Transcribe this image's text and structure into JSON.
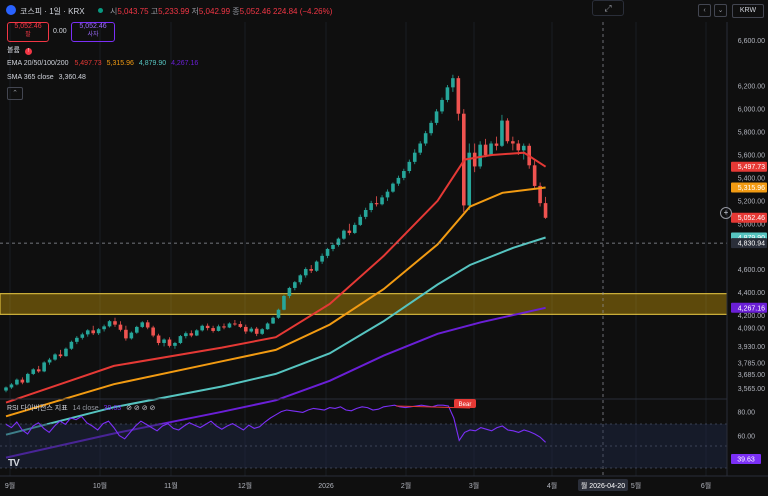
{
  "header": {
    "symbol_name": "코스피 · 1일 · KRX",
    "ohlc": {
      "open_label": "시",
      "open": "5,043.75",
      "high_label": "고",
      "high": "5,233.99",
      "low_label": "저",
      "low": "5,042.99",
      "close_label": "종",
      "close": "5,052.46",
      "change": "224.84 (−4.26%)"
    },
    "sell": {
      "price": "5,052.46",
      "label": "팔"
    },
    "spread": "0.00",
    "buy": {
      "price": "5,052.46",
      "label": "사자"
    },
    "currency": "KRW"
  },
  "indicators": {
    "volume_label": "볼륨",
    "ema_label": "EMA 20/50/100/200",
    "ema_values": [
      "5,497.73",
      "5,315.96",
      "4,879.90",
      "4,267.16"
    ],
    "sma_label": "SMA 365 close",
    "sma_value": "3,360.48"
  },
  "rsi": {
    "label": "RSI 다이버전스 지표",
    "params": "14 close",
    "value": "39.63",
    "bear_label": "Bear",
    "levels": [
      "80.00",
      "60.00"
    ]
  },
  "price_axis": {
    "ticks": [
      "6,600.00",
      "6,200.00",
      "6,000.00",
      "5,800.00",
      "5,600.00",
      "5,400.00",
      "5,200.00",
      "5,000.00",
      "4,600.00",
      "4,400.00",
      "4,200.00",
      "4,090.00",
      "3,930.00",
      "3,785.00",
      "3,685.00",
      "3,565.00"
    ],
    "labels": [
      {
        "text": "5,497.73",
        "color": "#e53935"
      },
      {
        "text": "5,315.96",
        "color": "#f29b12"
      },
      {
        "text": "5,052.46",
        "color": "#e53935"
      },
      {
        "text": "4,879.90",
        "color": "#56c4c0"
      },
      {
        "text": "4,830.94",
        "color": "#2a2e39"
      },
      {
        "text": "4,267.16",
        "color": "#6a1fd6"
      }
    ]
  },
  "time_axis": {
    "ticks": [
      "9월",
      "10월",
      "11월",
      "12월",
      "2026",
      "2월",
      "3월",
      "4월",
      "5월",
      "6월"
    ],
    "cursor_date": "월 2026-04-20"
  },
  "chart_data": {
    "type": "candlestick",
    "x_ticks": [
      "9월",
      "10월",
      "11월",
      "12월",
      "2026",
      "2월",
      "3월",
      "4월",
      "5월",
      "6월"
    ],
    "y_ticks": [
      6600,
      6200,
      6000,
      5800,
      5600,
      5400,
      5200,
      5000,
      4600,
      4400,
      4200,
      4090,
      3930,
      3785,
      3685,
      3565
    ],
    "ylim": [
      3480,
      6760
    ],
    "candles": [
      [
        3545,
        3580,
        3530,
        3572
      ],
      [
        3572,
        3610,
        3560,
        3598
      ],
      [
        3598,
        3650,
        3590,
        3640
      ],
      [
        3640,
        3660,
        3600,
        3615
      ],
      [
        3615,
        3700,
        3610,
        3690
      ],
      [
        3690,
        3740,
        3680,
        3730
      ],
      [
        3730,
        3760,
        3700,
        3712
      ],
      [
        3712,
        3800,
        3705,
        3790
      ],
      [
        3790,
        3830,
        3770,
        3815
      ],
      [
        3815,
        3870,
        3805,
        3860
      ],
      [
        3860,
        3900,
        3830,
        3845
      ],
      [
        3845,
        3920,
        3840,
        3910
      ],
      [
        3910,
        3980,
        3900,
        3970
      ],
      [
        3970,
        4020,
        3950,
        4005
      ],
      [
        4005,
        4050,
        3990,
        4035
      ],
      [
        4035,
        4080,
        4015,
        4070
      ],
      [
        4070,
        4110,
        4030,
        4045
      ],
      [
        4045,
        4090,
        4030,
        4080
      ],
      [
        4080,
        4120,
        4060,
        4105
      ],
      [
        4105,
        4160,
        4095,
        4150
      ],
      [
        4150,
        4180,
        4100,
        4120
      ],
      [
        4120,
        4150,
        4060,
        4075
      ],
      [
        4075,
        4110,
        3980,
        4000
      ],
      [
        4000,
        4060,
        3990,
        4050
      ],
      [
        4050,
        4110,
        4040,
        4100
      ],
      [
        4100,
        4150,
        4090,
        4140
      ],
      [
        4140,
        4160,
        4080,
        4095
      ],
      [
        4095,
        4110,
        4010,
        4025
      ],
      [
        4025,
        4040,
        3940,
        3960
      ],
      [
        3960,
        4000,
        3930,
        3990
      ],
      [
        3990,
        4010,
        3920,
        3935
      ],
      [
        3935,
        3970,
        3910,
        3960
      ],
      [
        3960,
        4030,
        3950,
        4020
      ],
      [
        4020,
        4060,
        4000,
        4045
      ],
      [
        4045,
        4070,
        4010,
        4025
      ],
      [
        4025,
        4080,
        4020,
        4070
      ],
      [
        4070,
        4120,
        4060,
        4110
      ],
      [
        4110,
        4130,
        4070,
        4090
      ],
      [
        4090,
        4110,
        4050,
        4065
      ],
      [
        4065,
        4120,
        4060,
        4105
      ],
      [
        4105,
        4130,
        4080,
        4095
      ],
      [
        4095,
        4140,
        4090,
        4130
      ],
      [
        4130,
        4160,
        4110,
        4125
      ],
      [
        4125,
        4150,
        4090,
        4100
      ],
      [
        4100,
        4120,
        4040,
        4060
      ],
      [
        4060,
        4100,
        4050,
        4085
      ],
      [
        4085,
        4100,
        4020,
        4040
      ],
      [
        4040,
        4090,
        4030,
        4080
      ],
      [
        4080,
        4140,
        4075,
        4130
      ],
      [
        4130,
        4190,
        4125,
        4180
      ],
      [
        4180,
        4260,
        4170,
        4250
      ],
      [
        4250,
        4380,
        4245,
        4370
      ],
      [
        4370,
        4450,
        4350,
        4440
      ],
      [
        4440,
        4500,
        4420,
        4490
      ],
      [
        4490,
        4560,
        4470,
        4550
      ],
      [
        4550,
        4620,
        4530,
        4605
      ],
      [
        4605,
        4640,
        4570,
        4590
      ],
      [
        4590,
        4680,
        4580,
        4670
      ],
      [
        4670,
        4740,
        4650,
        4720
      ],
      [
        4720,
        4790,
        4700,
        4780
      ],
      [
        4780,
        4830,
        4760,
        4815
      ],
      [
        4815,
        4880,
        4800,
        4870
      ],
      [
        4870,
        4950,
        4860,
        4940
      ],
      [
        4940,
        5000,
        4900,
        4920
      ],
      [
        4920,
        5010,
        4910,
        4990
      ],
      [
        4990,
        5080,
        4980,
        5060
      ],
      [
        5060,
        5140,
        5040,
        5120
      ],
      [
        5120,
        5200,
        5100,
        5180
      ],
      [
        5180,
        5240,
        5150,
        5170
      ],
      [
        5170,
        5250,
        5160,
        5230
      ],
      [
        5230,
        5300,
        5200,
        5280
      ],
      [
        5280,
        5360,
        5270,
        5350
      ],
      [
        5350,
        5420,
        5330,
        5400
      ],
      [
        5400,
        5480,
        5380,
        5460
      ],
      [
        5460,
        5560,
        5440,
        5540
      ],
      [
        5540,
        5650,
        5520,
        5620
      ],
      [
        5620,
        5720,
        5600,
        5700
      ],
      [
        5700,
        5810,
        5680,
        5790
      ],
      [
        5790,
        5900,
        5770,
        5880
      ],
      [
        5880,
        6000,
        5860,
        5980
      ],
      [
        5980,
        6100,
        5960,
        6080
      ],
      [
        6080,
        6210,
        6060,
        6190
      ],
      [
        6190,
        6300,
        6150,
        6270
      ],
      [
        6270,
        6290,
        5900,
        5960
      ],
      [
        5960,
        6000,
        5100,
        5160
      ],
      [
        5160,
        5700,
        5120,
        5620
      ],
      [
        5620,
        5700,
        5450,
        5500
      ],
      [
        5500,
        5720,
        5480,
        5690
      ],
      [
        5690,
        5740,
        5580,
        5600
      ],
      [
        5600,
        5720,
        5590,
        5700
      ],
      [
        5700,
        5760,
        5640,
        5680
      ],
      [
        5680,
        5950,
        5670,
        5900
      ],
      [
        5900,
        5920,
        5700,
        5720
      ],
      [
        5720,
        5760,
        5640,
        5700
      ],
      [
        5700,
        5730,
        5600,
        5640
      ],
      [
        5640,
        5700,
        5560,
        5680
      ],
      [
        5680,
        5700,
        5480,
        5510
      ],
      [
        5510,
        5560,
        5300,
        5330
      ],
      [
        5330,
        5360,
        5150,
        5180
      ],
      [
        5180,
        5234,
        5043,
        5052
      ]
    ],
    "series": [
      {
        "name": "EMA 20",
        "color": "#e53935",
        "values": [
          [
            0,
            3440
          ],
          [
            20,
            3760
          ],
          [
            40,
            3920
          ],
          [
            50,
            4010
          ],
          [
            60,
            4300
          ],
          [
            70,
            4720
          ],
          [
            80,
            5200
          ],
          [
            85,
            5560
          ],
          [
            90,
            5600
          ],
          [
            96,
            5620
          ],
          [
            100,
            5497.73
          ]
        ]
      },
      {
        "name": "EMA 50",
        "color": "#f29b12",
        "values": [
          [
            0,
            3320
          ],
          [
            20,
            3600
          ],
          [
            40,
            3800
          ],
          [
            50,
            3900
          ],
          [
            60,
            4120
          ],
          [
            70,
            4430
          ],
          [
            80,
            4820
          ],
          [
            86,
            5150
          ],
          [
            92,
            5270
          ],
          [
            100,
            5315.96
          ]
        ]
      },
      {
        "name": "EMA 100",
        "color": "#56c4c0",
        "values": [
          [
            0,
            3160
          ],
          [
            20,
            3400
          ],
          [
            40,
            3580
          ],
          [
            50,
            3690
          ],
          [
            60,
            3870
          ],
          [
            70,
            4150
          ],
          [
            80,
            4470
          ],
          [
            86,
            4640
          ],
          [
            94,
            4790
          ],
          [
            100,
            4879.9
          ]
        ]
      },
      {
        "name": "EMA 200",
        "color": "#6a1fd6",
        "values": [
          [
            0,
            2960
          ],
          [
            20,
            3170
          ],
          [
            40,
            3360
          ],
          [
            50,
            3460
          ],
          [
            60,
            3630
          ],
          [
            70,
            3850
          ],
          [
            80,
            4040
          ],
          [
            88,
            4140
          ],
          [
            100,
            4267.16
          ]
        ]
      }
    ],
    "zone": [
      4210,
      4390
    ],
    "crosshair_y": 4830.94,
    "rsi_values": [
      62,
      58,
      65,
      55,
      50,
      60,
      64,
      57,
      52,
      60,
      66,
      62,
      70,
      68,
      72,
      64,
      60,
      55,
      63,
      66,
      58,
      48,
      44,
      52,
      60,
      66,
      62,
      58,
      54,
      60,
      63,
      57,
      55,
      60,
      64,
      61,
      58,
      62,
      66,
      60,
      56,
      60,
      63,
      59,
      55,
      61,
      57,
      59,
      65,
      70,
      74,
      78,
      80,
      79,
      78,
      77,
      80,
      82,
      81,
      80,
      83,
      82,
      84,
      80,
      79,
      82,
      84,
      83,
      80,
      81,
      84,
      85,
      86,
      84,
      83,
      84,
      85,
      86,
      85,
      84,
      86,
      86,
      85,
      70,
      42,
      52,
      55,
      54,
      58,
      56,
      54,
      58,
      60,
      55,
      54,
      52,
      55,
      53,
      50,
      46,
      39.63
    ],
    "rsi_ylim": [
      0,
      90
    ]
  }
}
